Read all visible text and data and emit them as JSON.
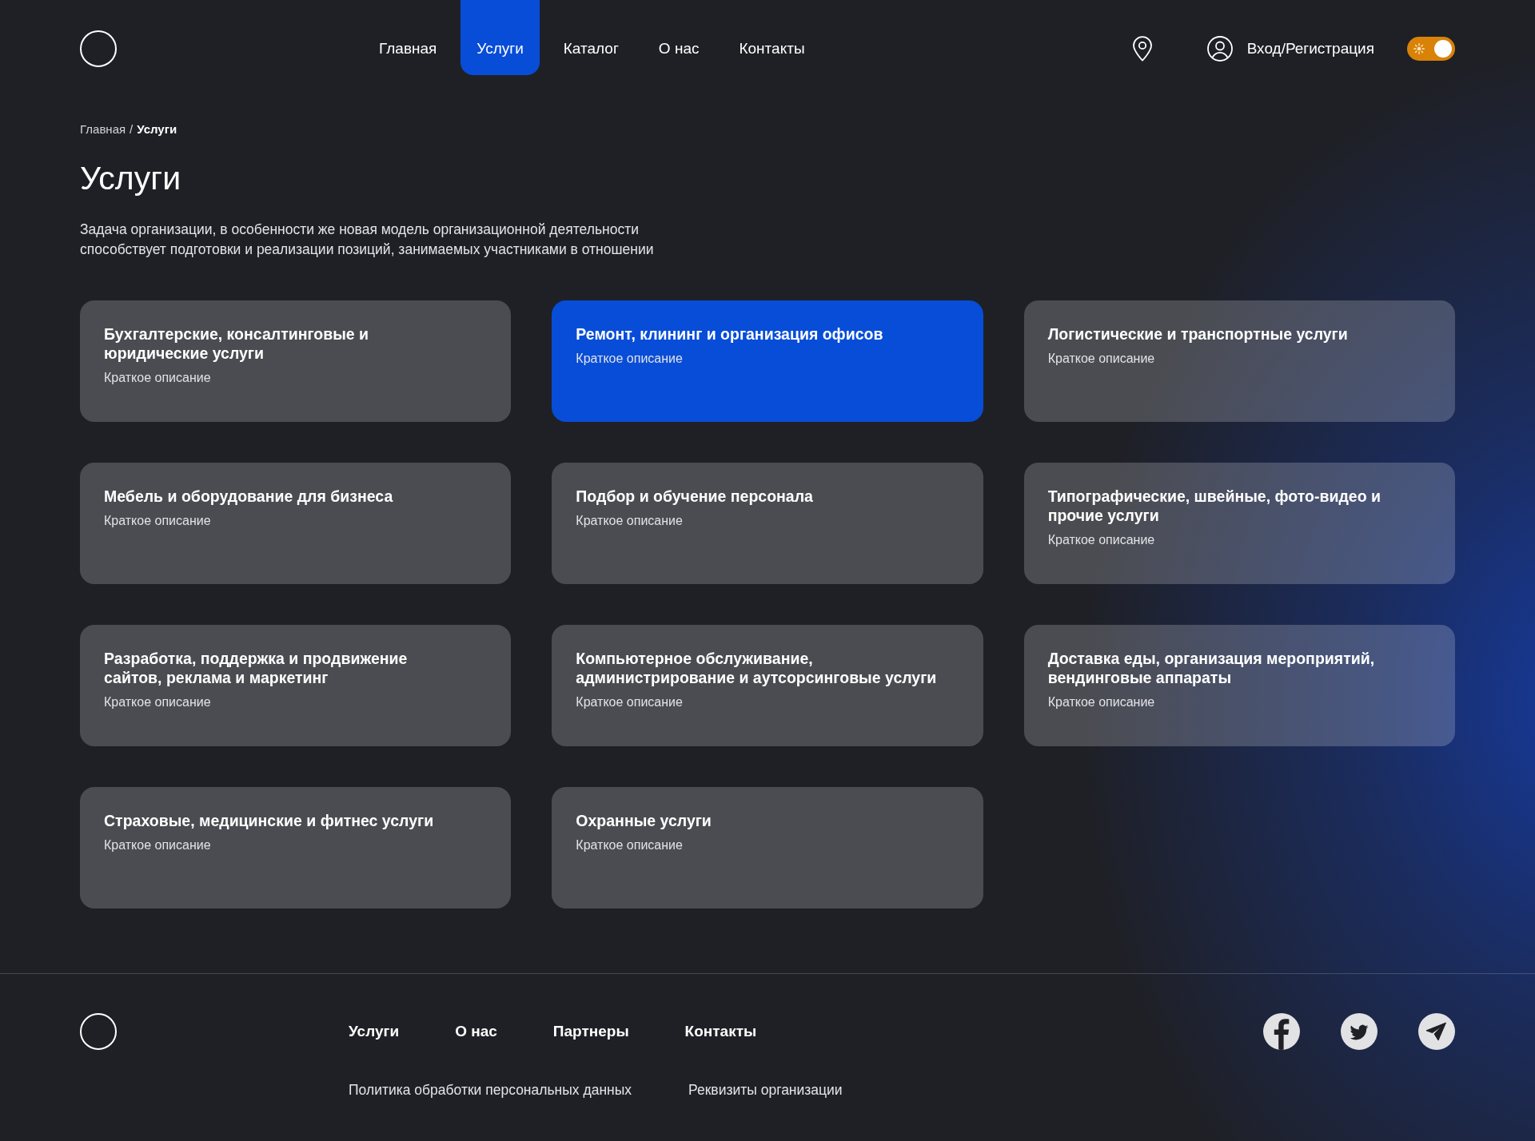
{
  "header": {
    "nav": [
      {
        "label": "Главная",
        "selected": false
      },
      {
        "label": "Услуги",
        "selected": true
      },
      {
        "label": "Каталог",
        "selected": false
      },
      {
        "label": "О нас",
        "selected": false
      },
      {
        "label": "Контакты",
        "selected": false
      }
    ],
    "login": "Вход/Регистрация",
    "theme_toggle": {
      "on": true
    }
  },
  "breadcrumb": {
    "separator": "/",
    "items": [
      {
        "label": "Главная",
        "selected": false
      },
      {
        "label": "Услуги",
        "selected": true
      }
    ]
  },
  "title": "Услуги",
  "intro": [
    "Задача организации, в особенности же новая модель организационной деятельности",
    "способствует подготовки и реализации позиций, занимаемых участниками в отношении"
  ],
  "services": [
    {
      "title": [
        "Бухгалтерские, консалтинговые и",
        "юридические услуги"
      ],
      "description": "Краткое описание",
      "selected": false
    },
    {
      "title": [
        "Ремонт, клининг и организация офисов"
      ],
      "description": "Краткое описание",
      "selected": true
    },
    {
      "title": [
        "Логистические и транспортные услуги"
      ],
      "description": "Краткое описание",
      "selected": false
    },
    {
      "title": [
        "Мебель и оборудование для бизнеса"
      ],
      "description": "Краткое описание",
      "selected": false
    },
    {
      "title": [
        "Подбор и обучение персонала"
      ],
      "description": "Краткое описание",
      "selected": false
    },
    {
      "title": [
        "Типографические, швейные, фото-видео и",
        "прочие услуги"
      ],
      "description": "Краткое описание",
      "selected": false
    },
    {
      "title": [
        "Разработка, поддержка и продвижение",
        "сайтов, реклама и маркетинг"
      ],
      "description": "Краткое описание",
      "selected": false
    },
    {
      "title": [
        "Компьютерное обслуживание,",
        "администрирование и аутсорсинговые услуги"
      ],
      "description": "Краткое описание",
      "selected": false
    },
    {
      "title": [
        "Доставка еды, организация мероприятий,",
        "вендинговые аппараты"
      ],
      "description": "Краткое описание",
      "selected": false
    },
    {
      "title": [
        "Страховые, медицинские и фитнес услуги"
      ],
      "description": "Краткое описание",
      "selected": false
    },
    {
      "title": [
        "Охранные услуги"
      ],
      "description": "Краткое описание",
      "selected": false
    }
  ],
  "footer": {
    "nav": [
      "Услуги",
      "О нас",
      "Партнеры",
      "Контакты"
    ],
    "links": [
      "Политика обработки персональных данных",
      "Реквизиты организации"
    ]
  }
}
